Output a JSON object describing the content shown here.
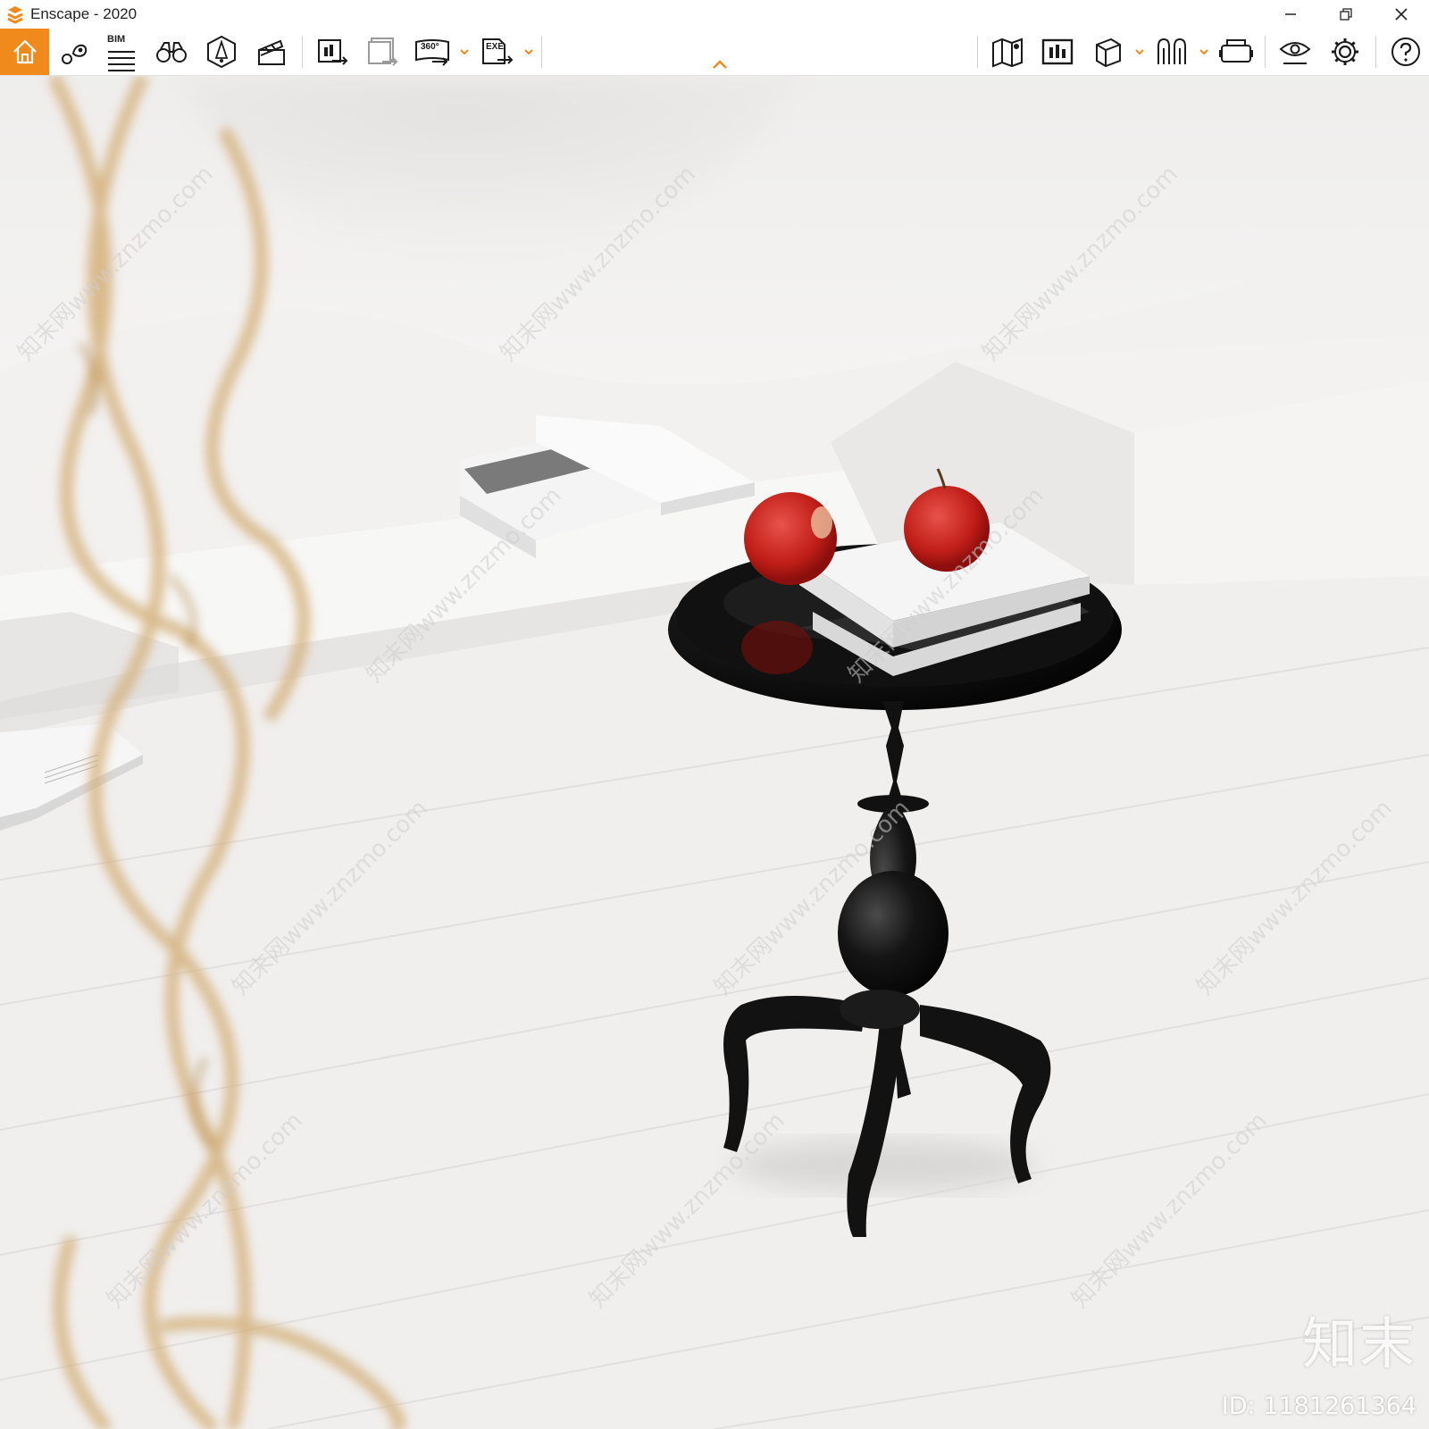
{
  "window": {
    "title": "Enscape - 2020"
  },
  "colors": {
    "accent": "#f08a1d",
    "icon_stroke": "#1a1a1a"
  },
  "toolbar": {
    "left_icons": [
      "home-icon",
      "pin-icon",
      "bim-icon",
      "binoculars-icon",
      "light-icon",
      "clapper-icon"
    ],
    "bim_label": "BIM",
    "export_icons": [
      "screenshot-export-icon",
      "batch-export-icon",
      "panorama-360-icon",
      "exe-export-icon"
    ],
    "pano_label": "360°",
    "exe_label": "EXE",
    "right_icons": [
      "map-icon",
      "views-icon",
      "cube-icon",
      "asset-icon",
      "vr-headset-icon",
      "visual-settings-icon",
      "gear-icon",
      "help-icon"
    ]
  },
  "watermark": {
    "site": "知末网www.znzmo.com",
    "brand": "知末",
    "id": "ID: 1181261364"
  }
}
